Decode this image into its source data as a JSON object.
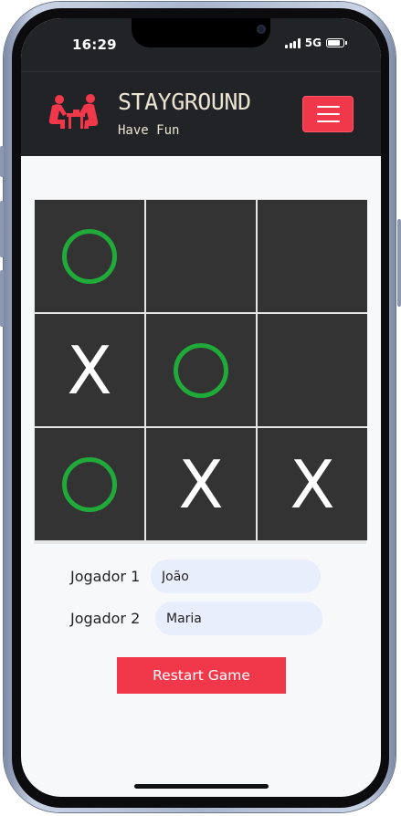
{
  "status_bar": {
    "time": "16:29",
    "network": "5G",
    "battery_level": 0.85
  },
  "navbar": {
    "brand": "STAYGROUND",
    "tagline": "Have Fun",
    "menu_icon": "hamburger-menu-icon",
    "brand_color": "#f0384a"
  },
  "board": {
    "cells": [
      "O",
      "",
      "",
      "X",
      "O",
      "",
      "O",
      "X",
      "X"
    ],
    "x_color": "#ffffff",
    "o_color": "#1faa3a",
    "cell_color": "#333333"
  },
  "players": {
    "player1_label": "Jogador 1",
    "player1_value": "João",
    "player2_label": "Jogador 2",
    "player2_value": "Maria"
  },
  "restart_label": "Restart Game"
}
